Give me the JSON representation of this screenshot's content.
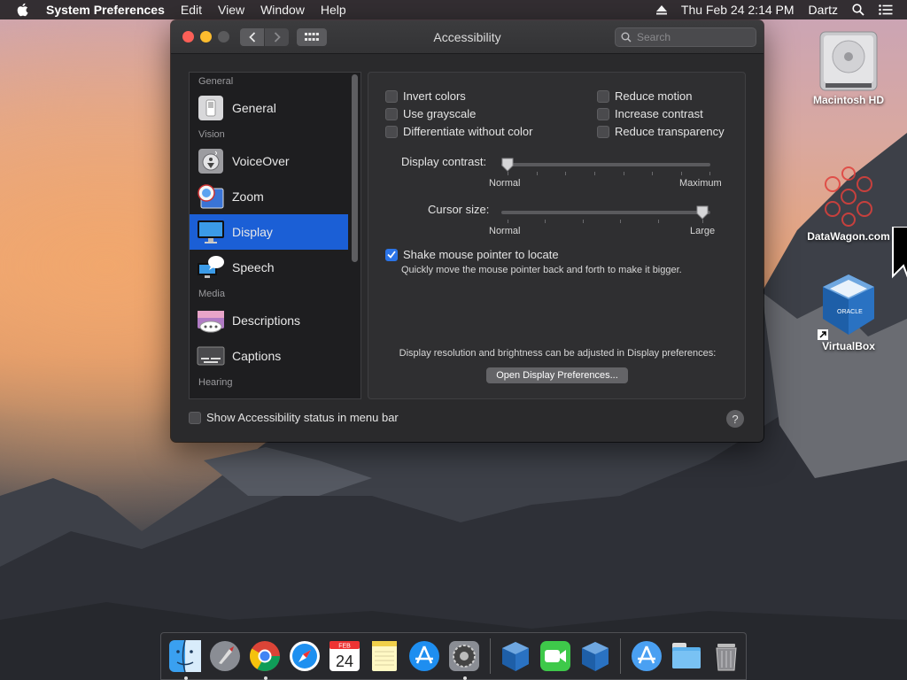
{
  "menubar": {
    "app_name": "System Preferences",
    "menus": [
      "Edit",
      "View",
      "Window",
      "Help"
    ],
    "datetime": "Thu Feb 24  2:14 PM",
    "user": "Dartz"
  },
  "window": {
    "title": "Accessibility",
    "search_placeholder": "Search"
  },
  "sidebar": {
    "sections": {
      "general": "General",
      "vision": "Vision",
      "media": "Media",
      "hearing": "Hearing"
    },
    "items": [
      {
        "label": "General",
        "icon": "general-switch-icon"
      },
      {
        "label": "VoiceOver",
        "icon": "voiceover-icon"
      },
      {
        "label": "Zoom",
        "icon": "zoom-icon"
      },
      {
        "label": "Display",
        "icon": "display-icon",
        "selected": true
      },
      {
        "label": "Speech",
        "icon": "speech-icon"
      },
      {
        "label": "Descriptions",
        "icon": "descriptions-icon"
      },
      {
        "label": "Captions",
        "icon": "captions-icon"
      }
    ]
  },
  "display": {
    "options_left": [
      {
        "label": "Invert colors",
        "checked": false
      },
      {
        "label": "Use grayscale",
        "checked": false
      },
      {
        "label": "Differentiate without color",
        "checked": false
      }
    ],
    "options_right": [
      {
        "label": "Reduce motion",
        "checked": false
      },
      {
        "label": "Increase contrast",
        "checked": false
      },
      {
        "label": "Reduce transparency",
        "checked": false
      }
    ],
    "contrast": {
      "label": "Display contrast:",
      "min_label": "Normal",
      "max_label": "Maximum",
      "value": 0.0
    },
    "cursor": {
      "label": "Cursor size:",
      "min_label": "Normal",
      "max_label": "Large",
      "value": 1.0
    },
    "shake": {
      "label": "Shake mouse pointer to locate",
      "checked": true,
      "description": "Quickly move the mouse pointer back and forth to make it bigger."
    },
    "note": "Display resolution and brightness can be adjusted in Display preferences:",
    "open_button": "Open Display Preferences..."
  },
  "footer": {
    "status_label": "Show Accessibility status in menu bar",
    "status_checked": false,
    "help": "?"
  },
  "desktop": {
    "icons": [
      {
        "label": "Macintosh HD",
        "icon": "hard-drive-icon"
      },
      {
        "label": "DataWagon.com",
        "icon": "datawagon-logo-icon"
      },
      {
        "label": "VirtualBox",
        "icon": "virtualbox-icon"
      }
    ]
  },
  "dock": {
    "apps": [
      "finder-icon",
      "launchpad-icon",
      "chrome-icon",
      "safari-icon",
      "calendar-icon",
      "notes-icon",
      "app-store-icon",
      "system-preferences-icon",
      "virtualbox-icon",
      "facetime-icon",
      "virtualbox-icon",
      "app-store-icon",
      "folder-icon",
      "trash-icon"
    ],
    "calendar": {
      "month": "FEB",
      "day": "24"
    },
    "colors": {
      "accent": "#1b5fd6",
      "checkbox_checked": "#2b74e8"
    }
  }
}
